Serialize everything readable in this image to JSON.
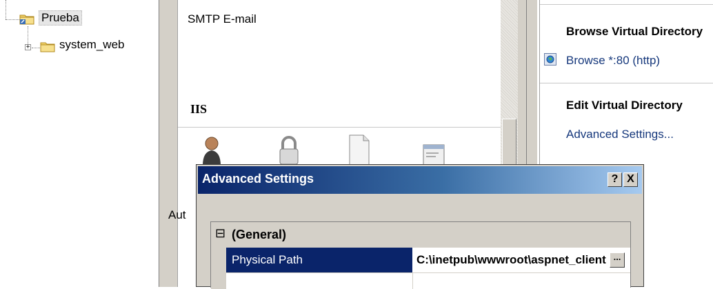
{
  "tree": {
    "items": [
      {
        "label": "Prueba",
        "selected": true
      },
      {
        "label": "system_web",
        "expander": "+"
      }
    ]
  },
  "features": {
    "top_item_label": "SMTP E-mail",
    "section_title": "IIS",
    "partial_label": "Aut",
    "icons": [
      "user-icon",
      "lock-icon",
      "document-icon",
      "window-icon"
    ]
  },
  "actions": {
    "browse_header": "Browse Virtual Directory",
    "browse_link": "Browse *:80 (http)",
    "edit_header": "Edit Virtual Directory",
    "advanced_link": "Advanced Settings..."
  },
  "dialog": {
    "title": "Advanced Settings",
    "help_button": "?",
    "close_button": "X",
    "category_expander": "⊟",
    "category": "(General)",
    "rows": [
      {
        "name": "Physical Path",
        "value": "C:\\inetpub\\wwwroot\\aspnet_client",
        "selected": true,
        "button": "..."
      }
    ]
  },
  "colors": {
    "selection": "#0a246a",
    "title_gradient_start": "#0a246a",
    "title_gradient_end": "#a6caf0",
    "link": "#16387c"
  }
}
